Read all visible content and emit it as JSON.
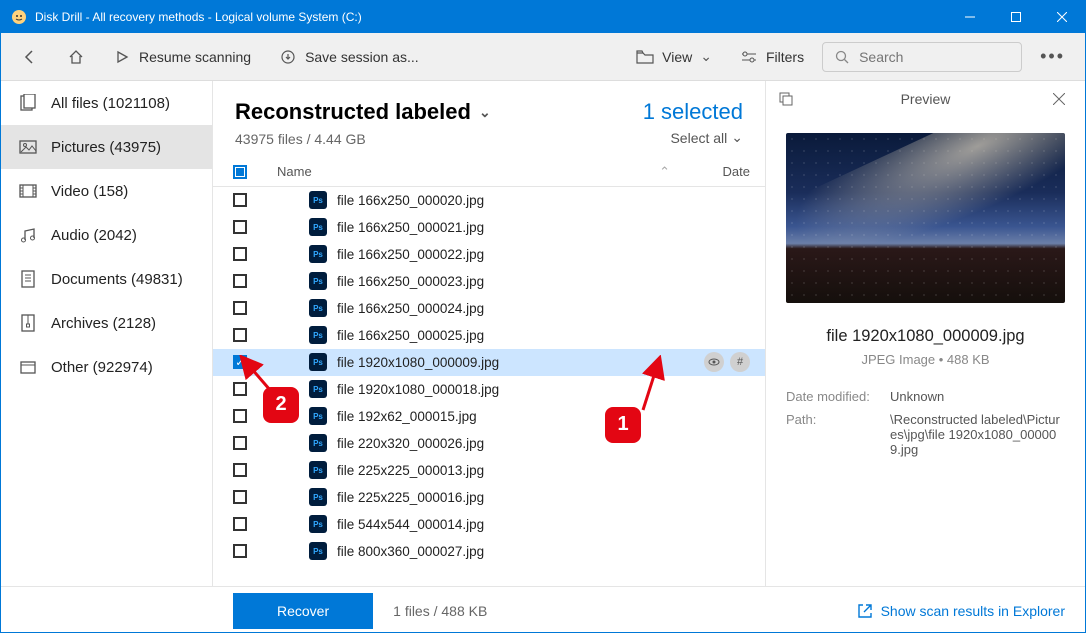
{
  "window": {
    "title": "Disk Drill - All recovery methods - Logical volume System (C:)"
  },
  "toolbar": {
    "resume": "Resume scanning",
    "save_session": "Save session as...",
    "view": "View",
    "filters": "Filters",
    "search_placeholder": "Search"
  },
  "sidebar": {
    "items": [
      {
        "label": "All files (1021108)"
      },
      {
        "label": "Pictures (43975)"
      },
      {
        "label": "Video (158)"
      },
      {
        "label": "Audio (2042)"
      },
      {
        "label": "Documents (49831)"
      },
      {
        "label": "Archives (2128)"
      },
      {
        "label": "Other (922974)"
      }
    ]
  },
  "header": {
    "title": "Reconstructed labeled",
    "subtitle": "43975 files / 4.44 GB",
    "selected": "1 selected",
    "select_all": "Select all"
  },
  "columns": {
    "name": "Name",
    "date": "Date"
  },
  "files": [
    {
      "name": "file 166x250_000020.jpg",
      "selected": false
    },
    {
      "name": "file 166x250_000021.jpg",
      "selected": false
    },
    {
      "name": "file 166x250_000022.jpg",
      "selected": false
    },
    {
      "name": "file 166x250_000023.jpg",
      "selected": false
    },
    {
      "name": "file 166x250_000024.jpg",
      "selected": false
    },
    {
      "name": "file 166x250_000025.jpg",
      "selected": false
    },
    {
      "name": "file 1920x1080_000009.jpg",
      "selected": true
    },
    {
      "name": "file 1920x1080_000018.jpg",
      "selected": false
    },
    {
      "name": "file 192x62_000015.jpg",
      "selected": false
    },
    {
      "name": "file 220x320_000026.jpg",
      "selected": false
    },
    {
      "name": "file 225x225_000013.jpg",
      "selected": false
    },
    {
      "name": "file 225x225_000016.jpg",
      "selected": false
    },
    {
      "name": "file 544x544_000014.jpg",
      "selected": false
    },
    {
      "name": "file 800x360_000027.jpg",
      "selected": false
    }
  ],
  "preview": {
    "title": "Preview",
    "filename": "file 1920x1080_000009.jpg",
    "filetype": "JPEG Image • 488 KB",
    "date_modified_label": "Date modified:",
    "date_modified": "Unknown",
    "path_label": "Path:",
    "path": "\\Reconstructed labeled\\Pictures\\jpg\\file 1920x1080_000009.jpg"
  },
  "bottom": {
    "recover": "Recover",
    "info": "1 files / 488 KB",
    "explorer": "Show scan results in Explorer"
  },
  "annotations": {
    "badge1": "1",
    "badge2": "2"
  }
}
